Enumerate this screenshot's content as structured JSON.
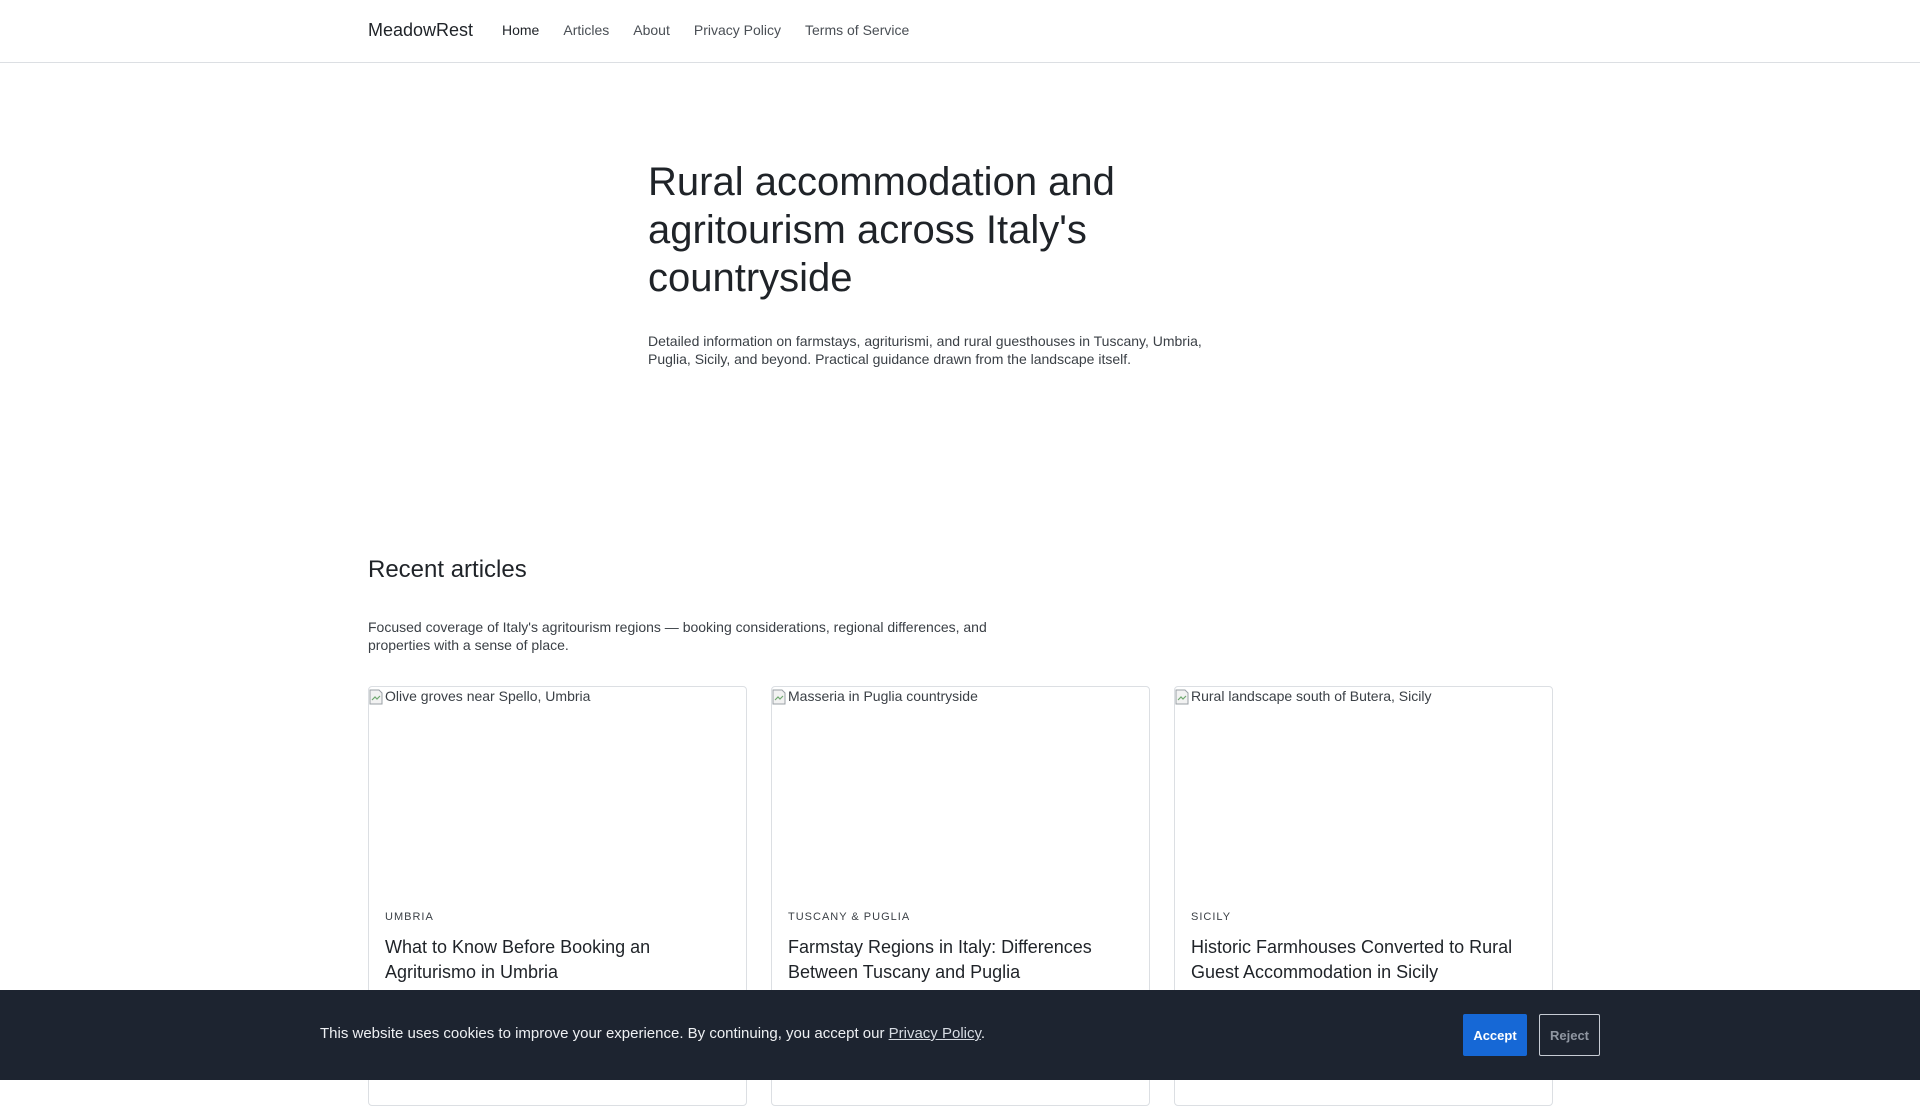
{
  "header": {
    "brand": "MeadowRest",
    "nav": [
      {
        "label": "Home"
      },
      {
        "label": "Articles"
      },
      {
        "label": "About"
      },
      {
        "label": "Privacy Policy"
      },
      {
        "label": "Terms of Service"
      }
    ]
  },
  "hero": {
    "title": "Rural accommodation and agritourism across Italy's countryside",
    "subtitle": "Detailed information on farmstays, agriturismi, and rural guesthouses in Tuscany, Umbria, Puglia, Sicily, and beyond. Practical guidance drawn from the landscape itself."
  },
  "recent": {
    "heading": "Recent articles",
    "intro": "Focused coverage of Italy's agritourism regions — booking considerations, regional differences, and properties with a sense of place.",
    "cards": [
      {
        "image_alt": "Olive groves near Spello, Umbria",
        "region": "UMBRIA",
        "title": "What to Know Before Booking an Agriturismo in Umbria"
      },
      {
        "image_alt": "Masseria in Puglia countryside",
        "region": "TUSCANY & PUGLIA",
        "title": "Farmstay Regions in Italy: Differences Between Tuscany and Puglia"
      },
      {
        "image_alt": "Rural landscape south of Butera, Sicily",
        "region": "SICILY",
        "title": "Historic Farmhouses Converted to Rural Guest Accommodation in Sicily"
      }
    ]
  },
  "cookie": {
    "message": "This website uses cookies to improve your experience. By continuing, you accept our ",
    "link": "Privacy Policy",
    "period": ".",
    "accept": "Accept",
    "reject": "Reject"
  }
}
